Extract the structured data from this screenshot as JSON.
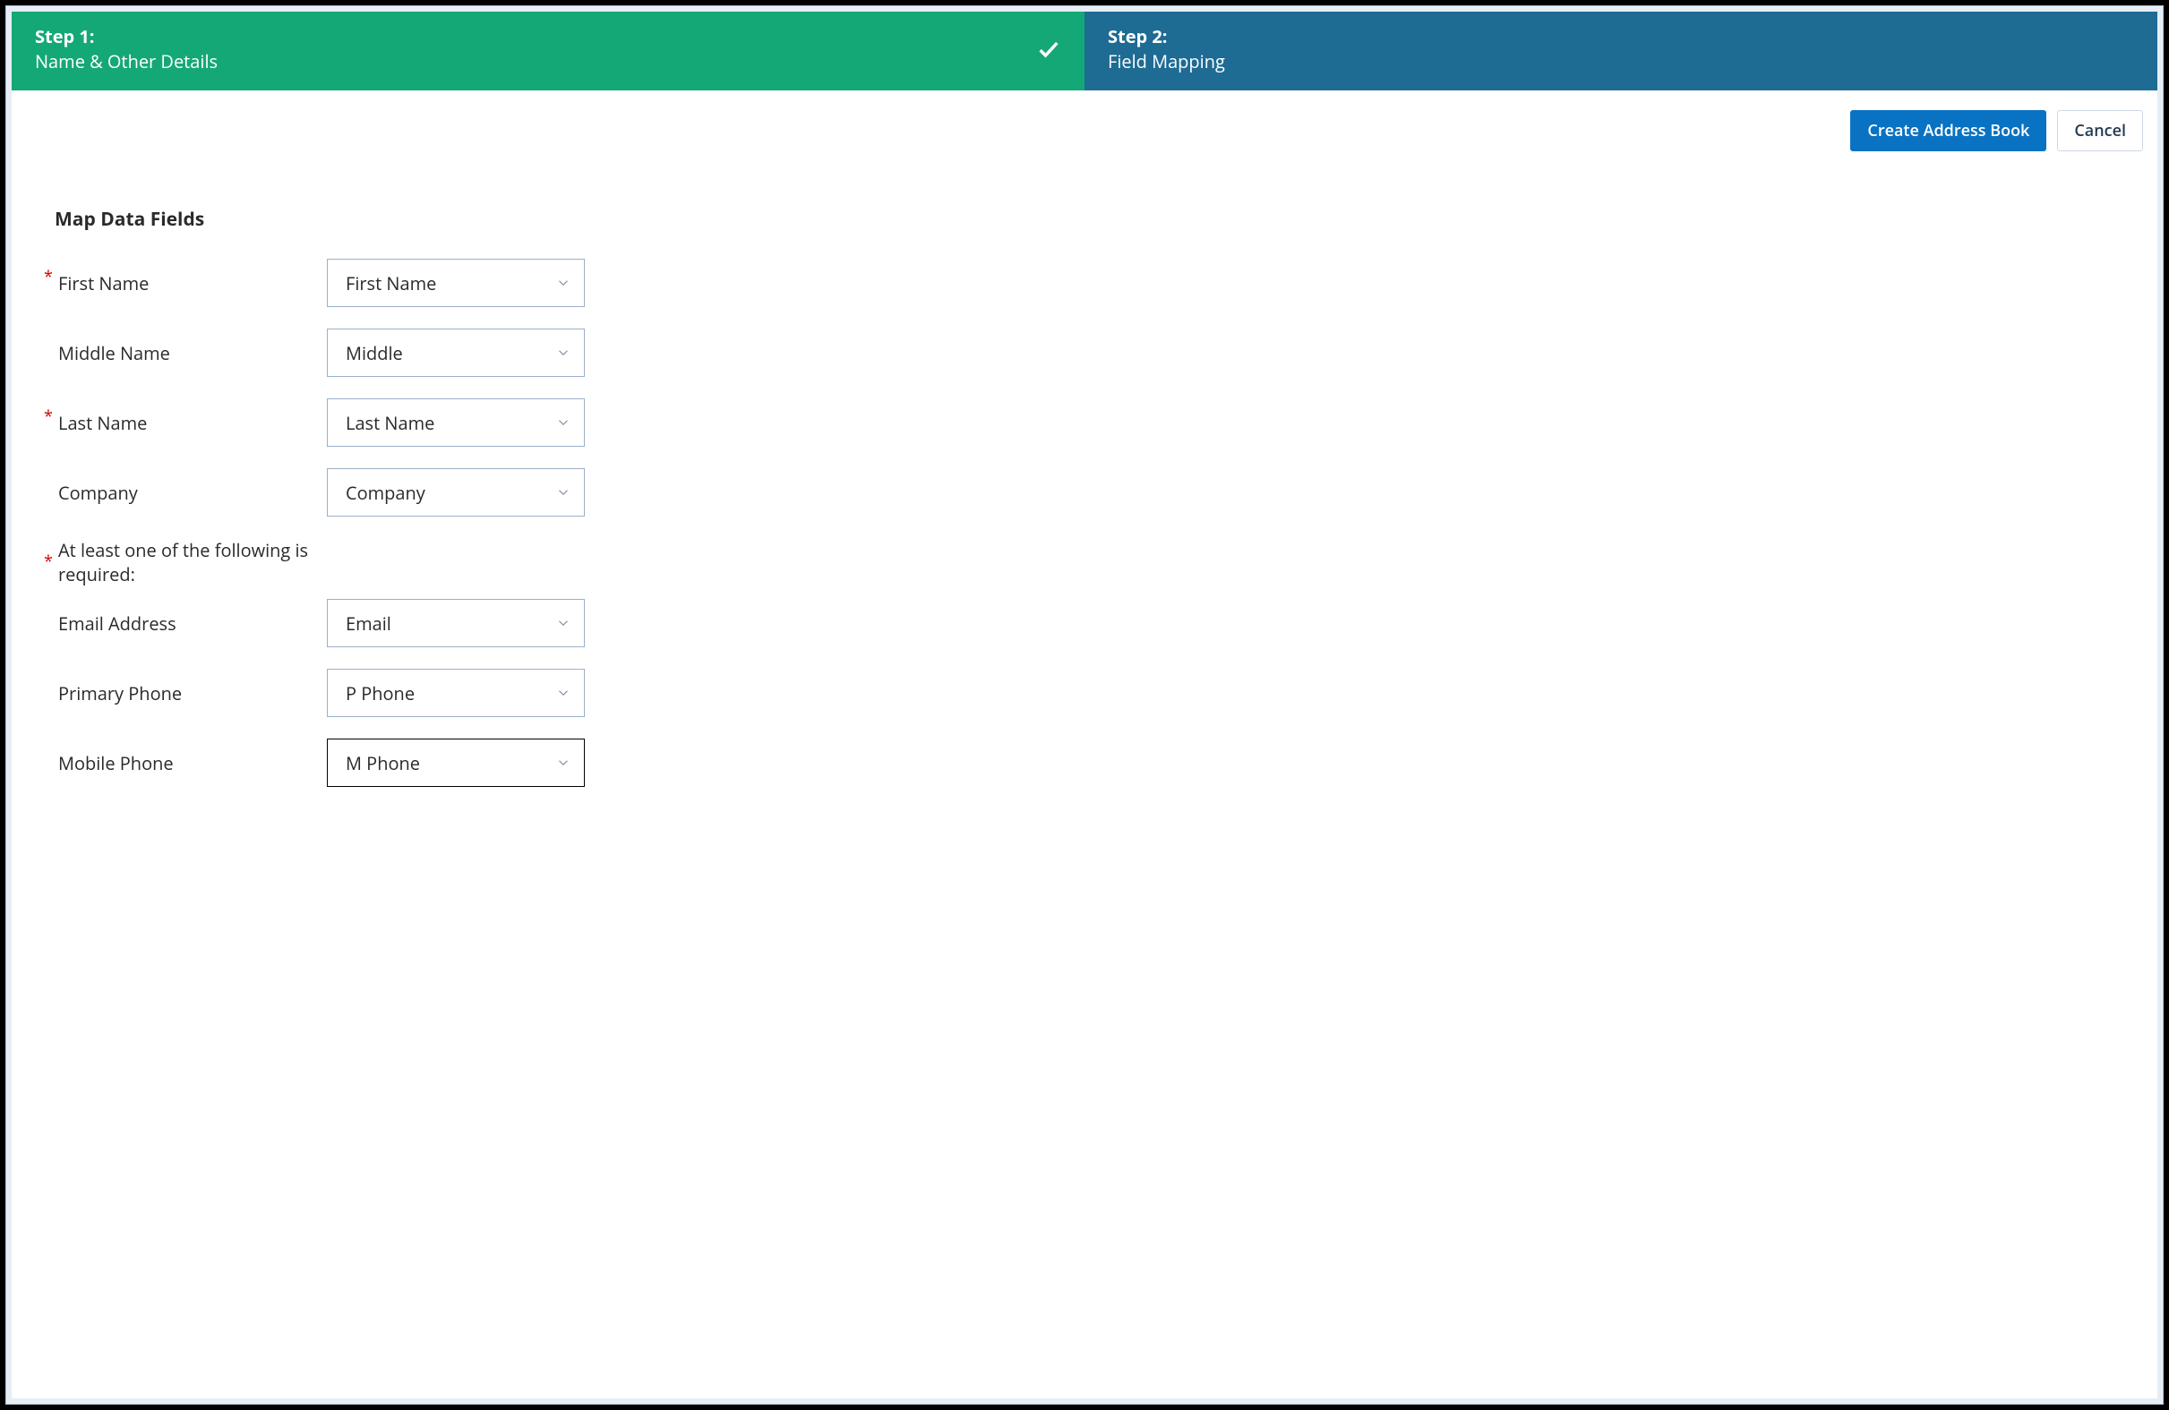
{
  "stepper": {
    "step1": {
      "title": "Step 1:",
      "subtitle": "Name & Other Details"
    },
    "step2": {
      "title": "Step 2:",
      "subtitle": "Field Mapping"
    }
  },
  "actions": {
    "primary": "Create Address Book",
    "cancel": "Cancel"
  },
  "section_title": "Map Data Fields",
  "required_mark": "*",
  "note": "At least one of the following is required:",
  "fields": {
    "first_name": {
      "label": "First Name",
      "value": "First Name",
      "required": true
    },
    "middle_name": {
      "label": "Middle Name",
      "value": "Middle",
      "required": false
    },
    "last_name": {
      "label": "Last Name",
      "value": "Last Name",
      "required": true
    },
    "company": {
      "label": "Company",
      "value": "Company",
      "required": false
    },
    "email": {
      "label": "Email Address",
      "value": "Email",
      "required": false
    },
    "primary_phone": {
      "label": "Primary Phone",
      "value": "P Phone",
      "required": false
    },
    "mobile_phone": {
      "label": "Mobile Phone",
      "value": "M Phone",
      "required": false
    }
  }
}
